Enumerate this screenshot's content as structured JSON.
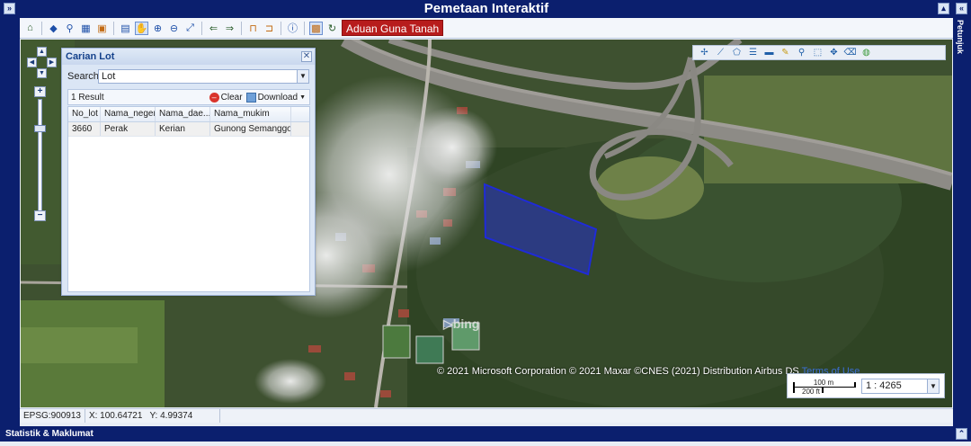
{
  "header": {
    "title": "Pemetaan Interaktif"
  },
  "side_right": {
    "label": "Petunjuk"
  },
  "toolbar": {
    "aduan_label": "Aduan Guna Tanah"
  },
  "panel": {
    "title": "Carian Lot",
    "search_label": "Search:",
    "search_value": "Lot",
    "result_count": "1 Result",
    "clear_label": "Clear",
    "download_label": "Download",
    "columns": [
      "No_lot",
      "Nama_negeri",
      "Nama_dae...",
      "Nama_mukim"
    ],
    "rows": [
      [
        "3660",
        "Perak",
        "Kerian",
        "Gunong Semanggol"
      ]
    ]
  },
  "map": {
    "attribution": "© 2021 Microsoft Corporation © 2021 Maxar ©CNES (2021) Distribution Airbus DS",
    "terms_label": "Terms of Use",
    "bing_label": "bing",
    "scale": {
      "metric": "100 m",
      "imperial": "200 ft",
      "ratio": "1 : 4265"
    }
  },
  "status": {
    "epsg": "EPSG:900913",
    "x": "X: 100.64721",
    "y": "Y: 4.99374"
  },
  "bottom": {
    "title": "Statistik & Maklumat"
  }
}
